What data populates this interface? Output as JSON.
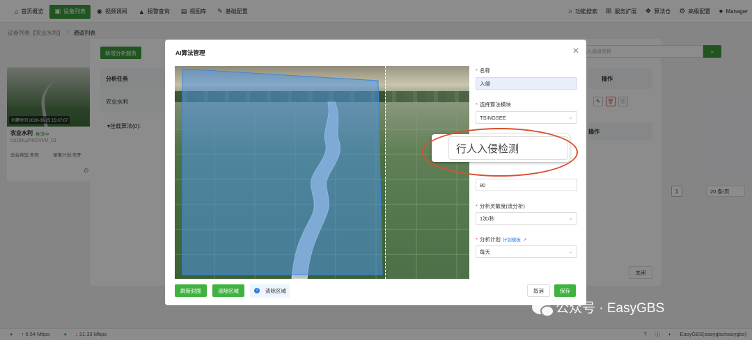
{
  "nav": {
    "items": [
      {
        "label": "首页概览",
        "icon": "home-icon",
        "glyph": "⌂",
        "active": false
      },
      {
        "label": "设备列表",
        "icon": "device-icon",
        "glyph": "▣",
        "active": true
      },
      {
        "label": "视频调阅",
        "icon": "video-icon",
        "glyph": "◉",
        "active": false
      },
      {
        "label": "报警查询",
        "icon": "alarm-icon",
        "glyph": "▲",
        "active": false
      },
      {
        "label": "视图库",
        "icon": "gallery-icon",
        "glyph": "▤",
        "active": false
      },
      {
        "label": "基础配置",
        "icon": "edit-icon",
        "glyph": "✎",
        "active": false
      }
    ],
    "right": [
      {
        "label": "功能搜索",
        "icon": "search-icon",
        "glyph": "⌕"
      },
      {
        "label": "服务扩展",
        "icon": "grid-icon",
        "glyph": "⊞"
      },
      {
        "label": "算法仓",
        "icon": "dropbox-icon",
        "glyph": "❖"
      },
      {
        "label": "高级配置",
        "icon": "gear-icon",
        "glyph": "⚙"
      },
      {
        "label": "Manager",
        "icon": "user-icon",
        "glyph": "●"
      }
    ]
  },
  "breadcrumb": {
    "parent": "设备列表【农业水利】",
    "sep": "/",
    "current": "通道列表"
  },
  "card": {
    "timestamp": "创建时间 2026-06-25 15:07:07",
    "name": "农业水利",
    "status": "推流中",
    "device_id": "UzDNLyRKSVVU_01",
    "tag1": "云台类型:未知",
    "tag2": "录像计划:未开"
  },
  "bg": {
    "add_button": "新增分析服务",
    "search_placeholder": "请输入通道名称",
    "col_task": "分析任务",
    "row_task": "农业水利",
    "mount": "▾挂载算法(0):",
    "col_op": "操作",
    "col_op2": "操作",
    "page": "1",
    "page_size": "20 条/页",
    "close": "关闭"
  },
  "dialog": {
    "title": "AI算法管理",
    "refresh_btn": "刷新封面",
    "clear_btn": "清除区域",
    "info_text": "清除区域",
    "name_label": "名称",
    "name_value": "入侵",
    "module_label": "选择算法模块",
    "module_value": "TSINGSEE",
    "threshold_value": "80",
    "sens_label": "分析灵敏度(流分析)",
    "sens_value": "1次/秒",
    "plan_label": "分析计划",
    "plan_link": "计划模板",
    "plan_value": "每天",
    "cancel": "取消",
    "save": "保存"
  },
  "popup": {
    "text": "行人入侵检测"
  },
  "status": {
    "up": "↑ 6.54 Mbps",
    "down": "↓ 21.33 Mbps",
    "right": "EasyGBS(easygbs/easygbs)"
  },
  "watermark": "公众号 · EasyGBS",
  "colors": {
    "accent": "#3c9a3c",
    "danger": "#e04848",
    "link": "#2f7be8",
    "highlight": "#d8502f"
  }
}
